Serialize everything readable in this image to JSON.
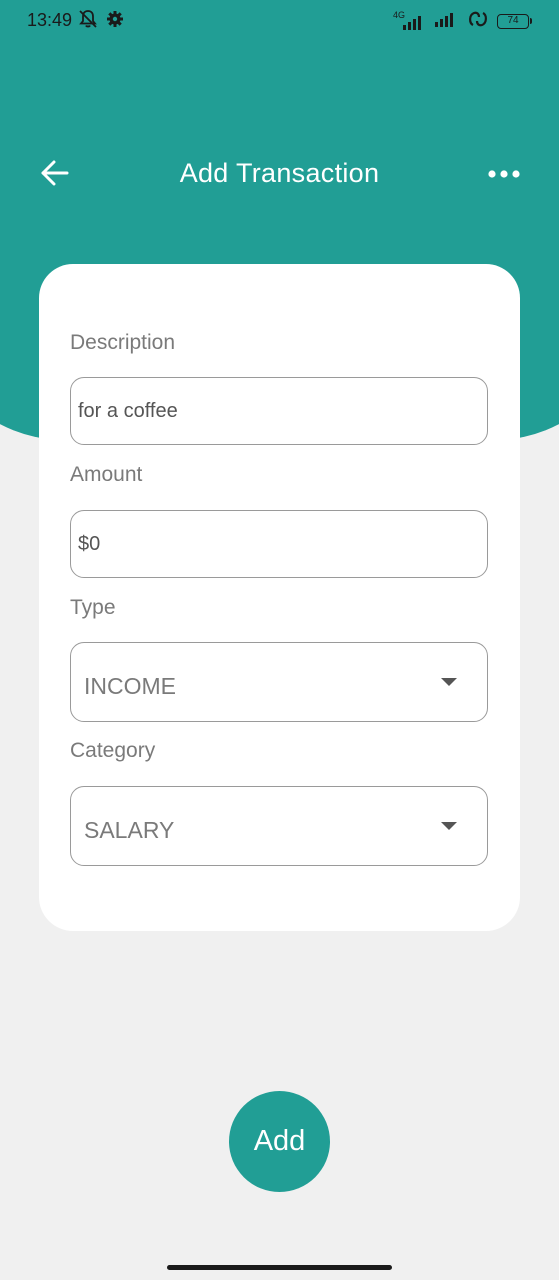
{
  "status_bar": {
    "time": "13:49",
    "network_label": "4G",
    "battery_level": "74",
    "icons": [
      "bell-muted-icon",
      "settings-gear-icon",
      "signal-4g-icon",
      "signal-icon",
      "sync-icon",
      "battery-icon"
    ]
  },
  "app_bar": {
    "title": "Add Transaction",
    "back_icon": "arrow-left-icon",
    "more_icon": "more-horizontal-icon"
  },
  "form": {
    "description": {
      "label": "Description",
      "value": "for a coffee"
    },
    "amount": {
      "label": "Amount",
      "value": "$0"
    },
    "type": {
      "label": "Type",
      "selected": "INCOME"
    },
    "category": {
      "label": "Category",
      "selected": "SALARY"
    }
  },
  "actions": {
    "add_label": "Add"
  },
  "colors": {
    "primary": "#219e95",
    "background": "#f0f0f0",
    "card": "#ffffff",
    "label": "#7a7a7a"
  }
}
